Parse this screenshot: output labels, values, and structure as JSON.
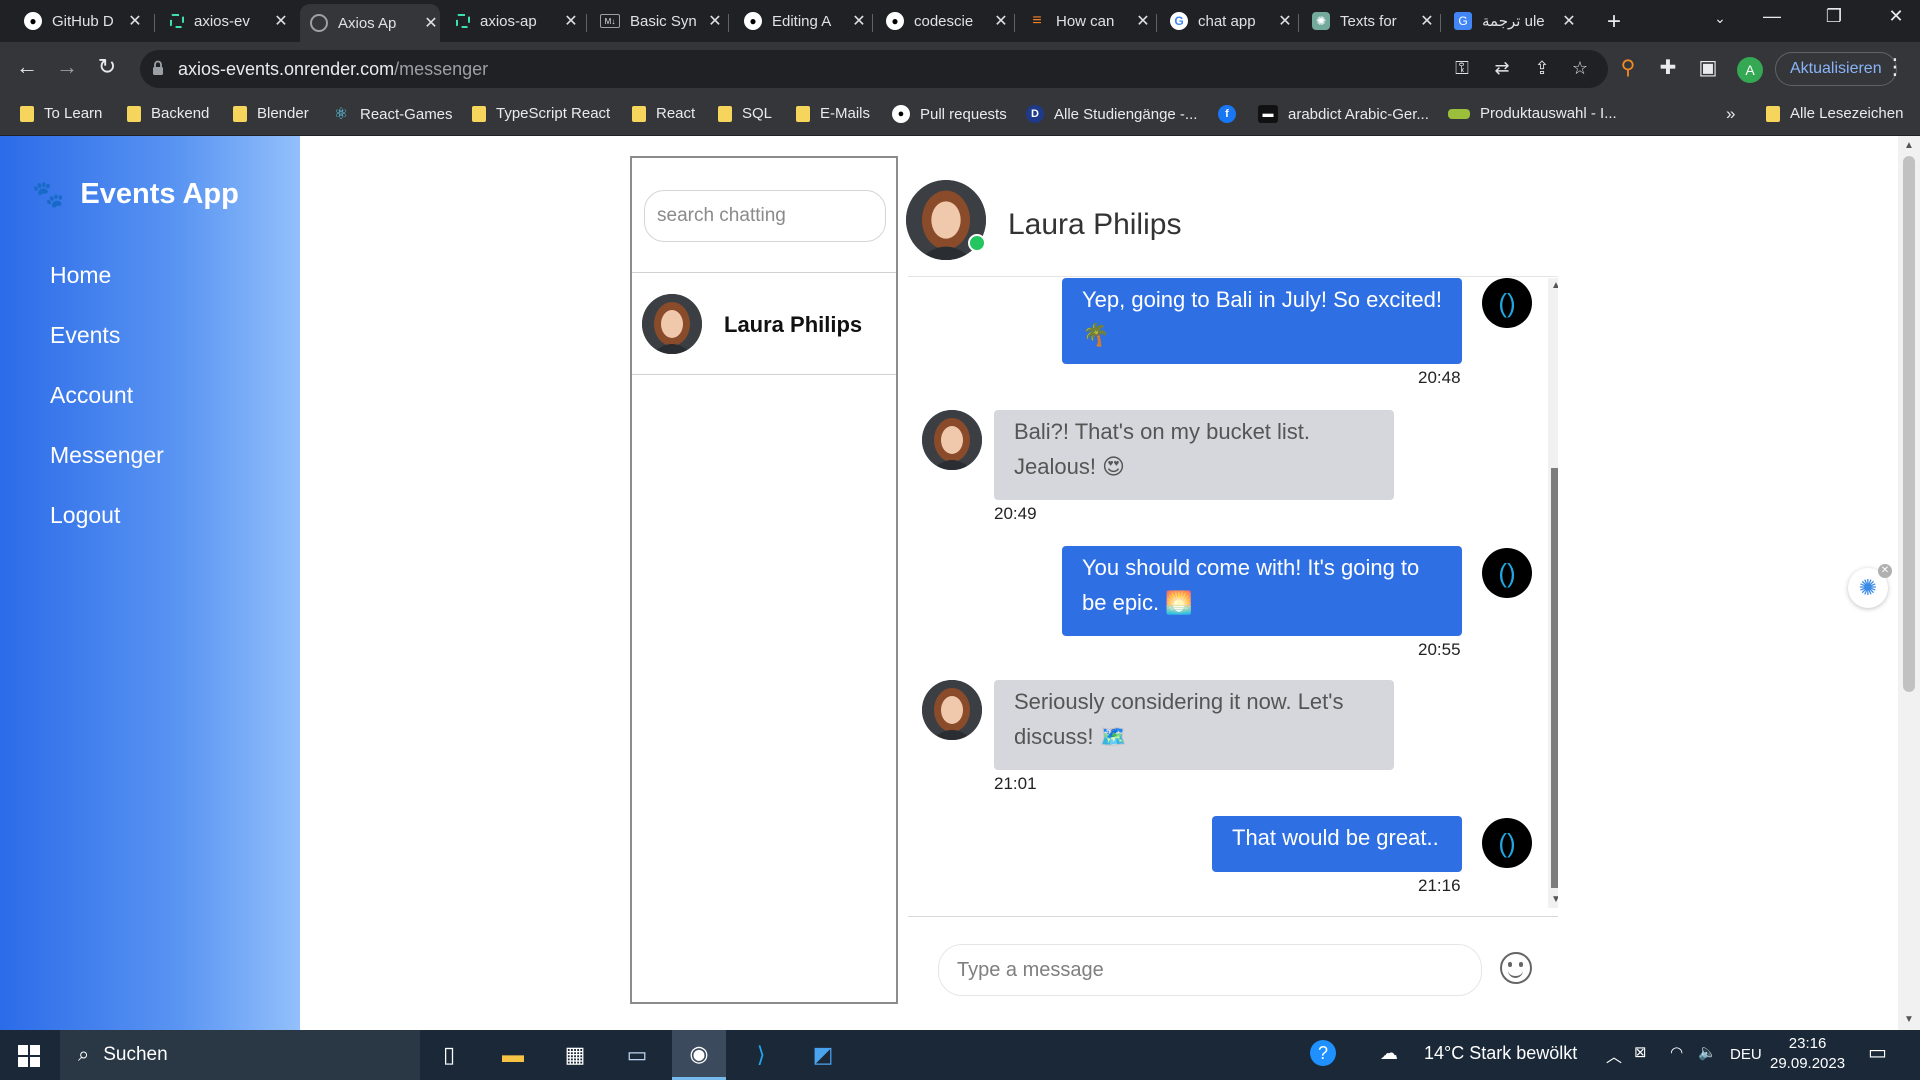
{
  "browser": {
    "tabs": [
      {
        "label": "GitHub D",
        "icon": "github-icon",
        "active": false
      },
      {
        "label": "axios-ev",
        "icon": "render-icon",
        "active": false
      },
      {
        "label": "Axios Ap",
        "icon": "globe-icon",
        "active": true
      },
      {
        "label": "axios-ap",
        "icon": "render-icon",
        "active": false
      },
      {
        "label": "Basic Syn",
        "icon": "md-icon",
        "active": false
      },
      {
        "label": "Editing A",
        "icon": "github-icon",
        "active": false
      },
      {
        "label": "codescie",
        "icon": "github-icon",
        "active": false
      },
      {
        "label": "How can",
        "icon": "stackoverflow-icon",
        "active": false
      },
      {
        "label": "chat app",
        "icon": "google-icon",
        "active": false
      },
      {
        "label": "Texts for",
        "icon": "chatgpt-icon",
        "active": false
      },
      {
        "label": "ترجمة ule",
        "icon": "translate-icon",
        "active": false
      }
    ],
    "url_host": "axios-events.onrender.com",
    "url_path": "/messenger",
    "update_label": "Aktualisieren",
    "profile_initial": "A",
    "bookmarks": [
      {
        "label": "To Learn",
        "type": "folder"
      },
      {
        "label": "Backend",
        "type": "folder"
      },
      {
        "label": "Blender",
        "type": "folder"
      },
      {
        "label": "React-Games",
        "type": "react-icon"
      },
      {
        "label": "TypeScript React",
        "type": "folder"
      },
      {
        "label": "React",
        "type": "folder"
      },
      {
        "label": "SQL",
        "type": "folder"
      },
      {
        "label": "E-Mails",
        "type": "folder"
      },
      {
        "label": "Pull requests",
        "type": "github-icon"
      },
      {
        "label": "Alle Studiengänge -...",
        "type": "d-icon"
      },
      {
        "label": "",
        "type": "facebook-icon"
      },
      {
        "label": "arabdict Arabic-Ger...",
        "type": "arabdict-icon"
      },
      {
        "label": "Produktauswahl - I...",
        "type": "product-icon"
      }
    ],
    "bookmarks_more": "»",
    "all_bookmarks": "Alle Lesezeichen"
  },
  "app": {
    "brand": "Events App",
    "nav": [
      "Home",
      "Events",
      "Account",
      "Messenger",
      "Logout"
    ]
  },
  "contacts": {
    "search_placeholder": "search chatting",
    "list": [
      {
        "name": "Laura Philips"
      }
    ]
  },
  "conversation": {
    "partner": "Laura Philips",
    "partner_online": true,
    "messages": [
      {
        "dir": "out",
        "text": "Yep, going to Bali in July! So excited! 🌴",
        "time": "20:48"
      },
      {
        "dir": "in",
        "text": "Bali?! That's on my bucket list. Jealous! 😍",
        "time": "20:49"
      },
      {
        "dir": "out",
        "text": "You should come with! It's going to be epic. 🌅",
        "time": "20:55"
      },
      {
        "dir": "in",
        "text": "Seriously considering it now. Let's discuss! 🗺️",
        "time": "21:01"
      },
      {
        "dir": "out",
        "text": "That would be great..",
        "time": "21:16"
      }
    ],
    "composer_placeholder": "Type a message"
  },
  "taskbar": {
    "search_label": "Suchen",
    "weather": "14°C  Stark bewölkt",
    "language": "DEU",
    "time": "23:16",
    "date": "29.09.2023"
  }
}
